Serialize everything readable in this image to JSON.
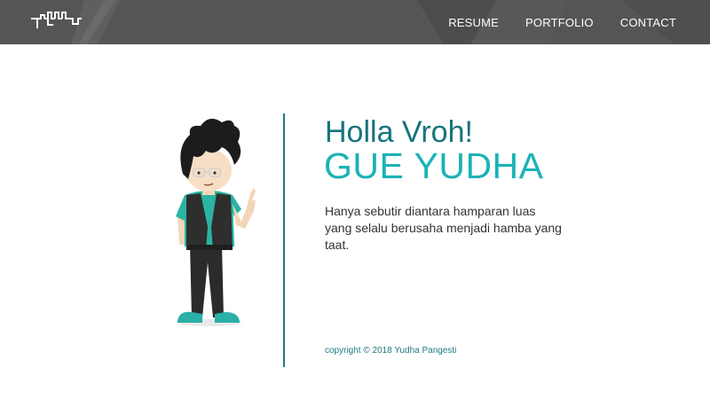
{
  "header": {
    "logo_alt": "yudha logo",
    "nav": [
      {
        "label": "RESUME"
      },
      {
        "label": "PORTFOLIO"
      },
      {
        "label": "CONTACT"
      }
    ]
  },
  "hero": {
    "greeting": "Holla Vroh!",
    "name": "GUE YUDHA",
    "tagline": "Hanya sebutir diantara hamparan luas yang selalu berusaha menjadi hamba yang taat."
  },
  "footer": {
    "copyright": "copyright © 2018 Yudha Pangesti"
  },
  "colors": {
    "navbar": "#555555",
    "accent_dark": "#17737b",
    "accent_light": "#1ab3b6",
    "vest": "#2e2e2e",
    "shirt": "#2bb3a3"
  },
  "icons": {
    "logo": "yudha-wordmark-logo",
    "character": "cartoon-boy-illustration"
  }
}
